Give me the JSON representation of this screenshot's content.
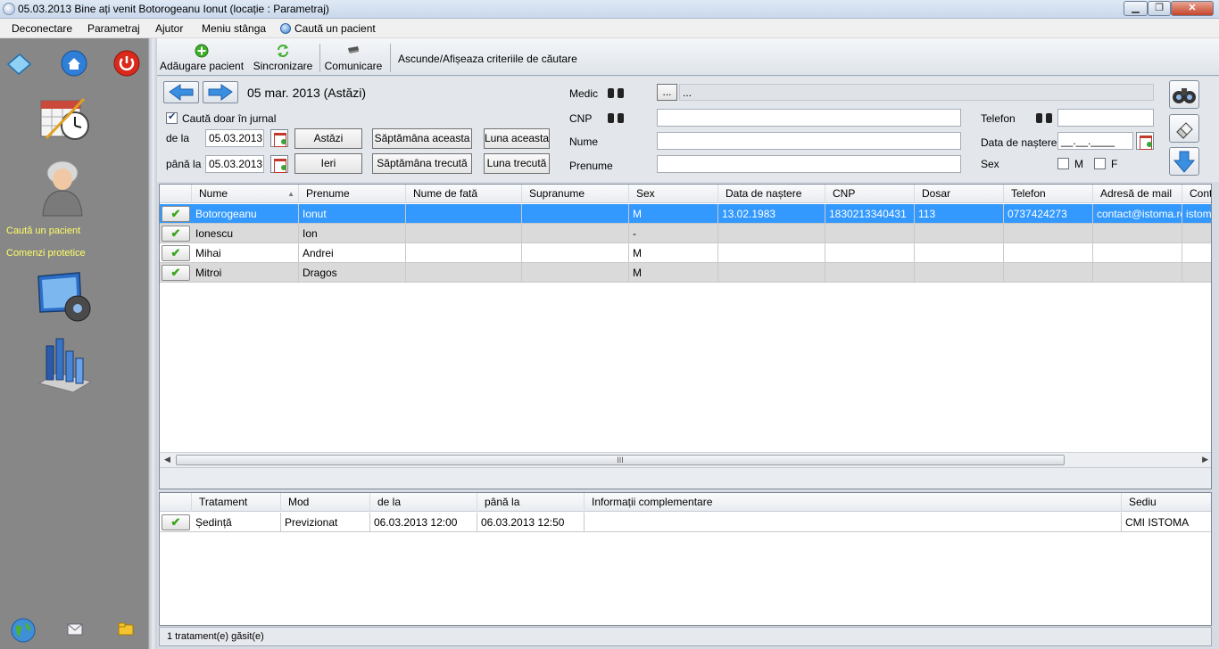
{
  "window": {
    "title": "05.03.2013 Bine ați venit Botorogeanu Ionut (locație : Parametraj)",
    "minimize_label": "▁",
    "maximize_label": "❐",
    "close_label": "✕"
  },
  "menu": {
    "items": [
      "Deconectare",
      "Parametraj",
      "Ajutor",
      "Meniu stânga",
      "Caută un pacient"
    ]
  },
  "toolbar": {
    "add_patient": "Adăugare pacient",
    "sync": "Sincronizare",
    "communicate": "Comunicare",
    "toggle_criteria": "Ascunde/Afișeaza criteriile de căutare"
  },
  "sidebar": {
    "links": [
      "Caută un pacient",
      "Comenzi protetice"
    ]
  },
  "search": {
    "date_title": "05 mar. 2013 (Astăzi)",
    "journal_only": "Caută doar în jurnal",
    "journal_only_checked": true,
    "from_label": "de la",
    "to_label": "până la",
    "from_value": "05.03.2013",
    "to_value": "05.03.2013",
    "btn_today": "Astăzi",
    "btn_yesterday": "Ieri",
    "btn_this_week": "Săptămâna aceasta",
    "btn_last_week": "Săptămâna trecută",
    "btn_this_month": "Luna aceasta",
    "btn_last_month": "Luna trecută",
    "medic_label": "Medic",
    "medic_btn": "...",
    "medic_value": "...",
    "cnp_label": "CNP",
    "nume_label": "Nume",
    "prenume_label": "Prenume",
    "telefon_label": "Telefon",
    "dob_label": "Data de naștere",
    "dob_value": "__.__.____",
    "sex_label": "Sex",
    "sex_m": "M",
    "sex_f": "F"
  },
  "patients": {
    "columns": [
      "Nume",
      "Prenume",
      "Nume de fată",
      "Supranume",
      "Sex",
      "Data de naștere",
      "CNP",
      "Dosar",
      "Telefon",
      "Adresă de mail",
      "Cont"
    ],
    "rows": [
      [
        "Botorogeanu",
        "Ionut",
        "",
        "",
        "M",
        "13.02.1983",
        "1830213340431",
        "113",
        "0737424273",
        "contact@istoma.ro",
        "istoma"
      ],
      [
        "Ionescu",
        "Ion",
        "",
        "",
        "-",
        "",
        "",
        "",
        "",
        "",
        ""
      ],
      [
        "Mihai",
        "Andrei",
        "",
        "",
        "M",
        "",
        "",
        "",
        "",
        "",
        ""
      ],
      [
        "Mitroi",
        "Dragos",
        "",
        "",
        "M",
        "",
        "",
        "",
        "",
        "",
        ""
      ]
    ],
    "row_button": "✔",
    "scroll_grip": "III"
  },
  "treatments": {
    "columns": [
      "Tratament",
      "Mod",
      "de la",
      "până la",
      "Informații complementare",
      "Sediu"
    ],
    "rows": [
      [
        "Ședință",
        "Previzionat",
        "06.03.2013 12:00",
        "06.03.2013 12:50",
        "",
        "CMI ISTOMA"
      ]
    ]
  },
  "status": {
    "text": "1 tratament(e) găsit(e)"
  }
}
